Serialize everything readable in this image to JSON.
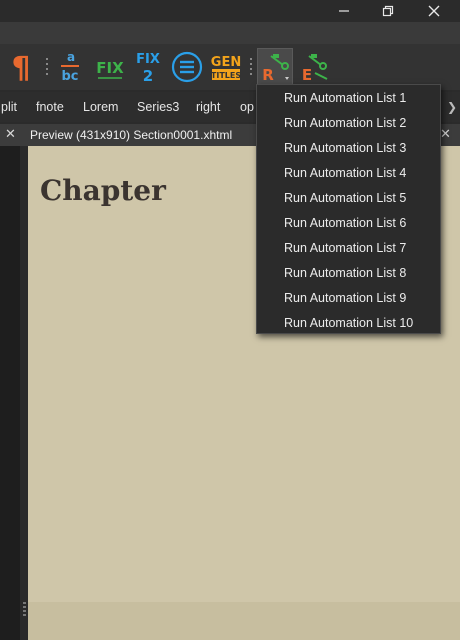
{
  "window": {
    "controls": [
      "minimize-icon",
      "restore-icon",
      "close-icon"
    ]
  },
  "toolbar": {
    "icons": [
      {
        "name": "paragraph-icon",
        "glyph": "¶",
        "color": "#e8692f"
      },
      {
        "name": "spellcheck-icon",
        "text_top": "a",
        "text_bottom": "bc",
        "color": "#4aa3df"
      },
      {
        "name": "fix-icon",
        "text": "FIX",
        "color": "#3db34a"
      },
      {
        "name": "fix2-icon",
        "text_top": "FIX",
        "text_bottom": "2",
        "color": "#2a9fe8"
      },
      {
        "name": "list-icon",
        "color": "#2a9fe8"
      },
      {
        "name": "gen-titles-icon",
        "text_top": "GEN",
        "text_bottom": "TITLES",
        "color": "#f2a31b"
      },
      {
        "name": "run-automation-icon",
        "letter": "R",
        "color": "#e8692f"
      },
      {
        "name": "edit-automation-icon",
        "letter": "E",
        "color": "#e8692f"
      }
    ]
  },
  "clips": {
    "items": [
      "plit",
      "fnote",
      "Lorem",
      "Series3",
      "right",
      "op"
    ]
  },
  "preview": {
    "tab_title": "Preview (431x910) Section0001.xhtml",
    "heading": "Chapter",
    "background": "#cfc6a9"
  },
  "menu": {
    "items": [
      "Run Automation List 1",
      "Run Automation List 2",
      "Run Automation List 3",
      "Run Automation List 4",
      "Run Automation List 5",
      "Run Automation List 6",
      "Run Automation List 7",
      "Run Automation List 8",
      "Run Automation List 9",
      "Run Automation List 10"
    ]
  }
}
